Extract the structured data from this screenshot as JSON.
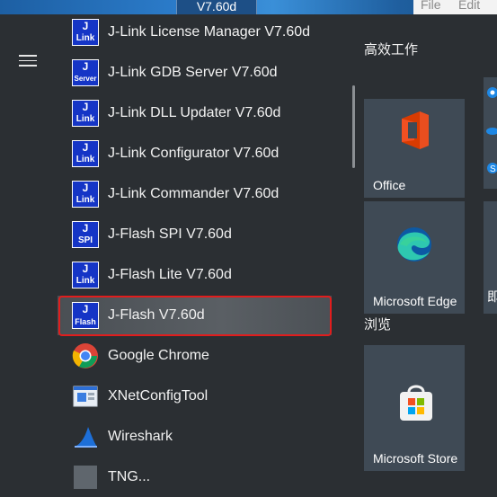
{
  "window": {
    "title": "V7.60d",
    "menu_file": "File",
    "menu_edit": "Edit"
  },
  "apps": [
    {
      "label": "J-Link License Manager V7.60d",
      "icon": "jlink-icon",
      "top": "J",
      "bottom": "Link"
    },
    {
      "label": "J-Link GDB Server V7.60d",
      "icon": "jlink-gdb-icon",
      "top": "J",
      "bottom": "Server"
    },
    {
      "label": "J-Link DLL Updater V7.60d",
      "icon": "jlink-icon",
      "top": "J",
      "bottom": "Link"
    },
    {
      "label": "J-Link Configurator V7.60d",
      "icon": "jlink-icon",
      "top": "J",
      "bottom": "Link"
    },
    {
      "label": "J-Link Commander V7.60d",
      "icon": "jlink-icon",
      "top": "J",
      "bottom": "Link"
    },
    {
      "label": "J-Flash SPI V7.60d",
      "icon": "jflash-spi-icon",
      "top": "J",
      "bottom": "SPI"
    },
    {
      "label": "J-Flash Lite V7.60d",
      "icon": "jlink-icon",
      "top": "J",
      "bottom": "Link"
    },
    {
      "label": "J-Flash V7.60d",
      "icon": "jflash-icon",
      "top": "J",
      "bottom": "Flash"
    },
    {
      "label": "Google Chrome",
      "icon": "chrome-icon"
    },
    {
      "label": "XNetConfigTool",
      "icon": "xnetconfig-icon"
    },
    {
      "label": "Wireshark",
      "icon": "wireshark-icon"
    },
    {
      "label": "TNG...",
      "icon": "app-icon"
    }
  ],
  "tiles": {
    "group1": "高效工作",
    "group2": "浏览",
    "office": "Office",
    "edge": "Microsoft Edge",
    "store": "Microsoft Store",
    "cut_label": "即"
  },
  "colors": {
    "accent": "#1535c6",
    "highlight": "#e11d1d"
  }
}
